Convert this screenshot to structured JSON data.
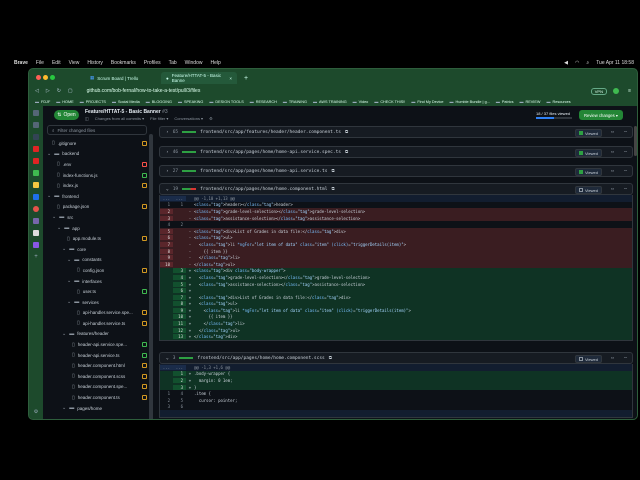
{
  "menubar": {
    "apple": "",
    "items": [
      "Brave",
      "File",
      "Edit",
      "View",
      "History",
      "Bookmarks",
      "Profiles",
      "Tab",
      "Window",
      "Help"
    ],
    "clock": "Tue Apr 11 18:58"
  },
  "tabs": [
    {
      "label": "Scrum Board | Trello"
    },
    {
      "label": "Feature/HTTAT-5 - Basic Banne"
    }
  ],
  "new_tab": "+",
  "address": "github.com/bob-fernal/how-to-take-a-test/pull/3/files",
  "vpn": "VPN",
  "bookmarks": [
    "FDJF",
    "HOME",
    "PROJECTS",
    "Social Media",
    "BLOGGING",
    "SPEAKING",
    "DESIGN TOOLS",
    "RESEARCH",
    "TRAINING",
    "AWS TRAINING",
    "Video",
    "CHECK THIS!!",
    "Find My Device",
    "Humble Bundle | g...",
    "Patrics",
    "REVIEW",
    "Resources"
  ],
  "colors": {
    "accent": "#238636",
    "del": "#3a1d21",
    "add": "#0f3324",
    "frame": "#1d4a2c"
  },
  "pr": {
    "state": "Open",
    "title": "Feature/HTTAT-5 - Basic Banner",
    "number": "#3",
    "changes": "Changes from all commits ▾",
    "file_filter": "File filter ▾",
    "conversations": "Conversations ▾",
    "files_viewed": "18 / 37 files viewed",
    "viewed_fraction": 0.49,
    "review": "Review changes ▾"
  },
  "filter_placeholder": "Filter changed files",
  "tree": [
    {
      "d": 0,
      "t": "f",
      "n": ".gitignore",
      "s": "mod"
    },
    {
      "d": 0,
      "t": "d",
      "n": "backend"
    },
    {
      "d": 1,
      "t": "f",
      "n": ".env",
      "s": "del"
    },
    {
      "d": 1,
      "t": "f",
      "n": "index-functions.js",
      "s": "add"
    },
    {
      "d": 1,
      "t": "f",
      "n": "index.js",
      "s": "mod"
    },
    {
      "d": 0,
      "t": "d",
      "n": "frontend"
    },
    {
      "d": 1,
      "t": "f",
      "n": "package.json",
      "s": "mod"
    },
    {
      "d": 1,
      "t": "d",
      "n": "src"
    },
    {
      "d": 2,
      "t": "d",
      "n": "app"
    },
    {
      "d": 3,
      "t": "f",
      "n": "app.module.ts",
      "s": "mod"
    },
    {
      "d": 3,
      "t": "d",
      "n": "core"
    },
    {
      "d": 4,
      "t": "d",
      "n": "constants"
    },
    {
      "d": 5,
      "t": "f",
      "n": "config.json",
      "s": "mod"
    },
    {
      "d": 4,
      "t": "d",
      "n": "interfaces"
    },
    {
      "d": 5,
      "t": "f",
      "n": "user.ts",
      "s": "add"
    },
    {
      "d": 4,
      "t": "d",
      "n": "services"
    },
    {
      "d": 5,
      "t": "f",
      "n": "api-handler.service.spe...",
      "s": "mod"
    },
    {
      "d": 5,
      "t": "f",
      "n": "api-handler.service.ts",
      "s": "mod"
    },
    {
      "d": 3,
      "t": "d",
      "n": "features/header"
    },
    {
      "d": 4,
      "t": "f",
      "n": "header-api.service.spe...",
      "s": "add"
    },
    {
      "d": 4,
      "t": "f",
      "n": "header-api.service.ts",
      "s": "add"
    },
    {
      "d": 4,
      "t": "f",
      "n": "header.component.html",
      "s": "mod"
    },
    {
      "d": 4,
      "t": "f",
      "n": "header.component.scss",
      "s": "mod"
    },
    {
      "d": 4,
      "t": "f",
      "n": "header.component.spe...",
      "s": "mod"
    },
    {
      "d": 4,
      "t": "f",
      "n": "header.component.ts",
      "s": "mod"
    },
    {
      "d": 3,
      "t": "d",
      "n": "pages/home"
    }
  ],
  "viewed_label": "Viewed",
  "collapsed_files": [
    {
      "count": "65",
      "path": "frontend/src/app/features/header/header.component.ts"
    },
    {
      "count": "46",
      "path": "frontend/src/app/pages/home/home-api.service.spec.ts"
    },
    {
      "count": "27",
      "path": "frontend/src/app/pages/home/home-api.service.ts"
    }
  ],
  "file1": {
    "count": "19",
    "path": "frontend/src/app/pages/home/home.component.html",
    "lines": [
      {
        "k": "hunk",
        "o": "...",
        "n": "...",
        "c": "@@ -1,10 +1,13 @@"
      },
      {
        "k": "ctx",
        "o": "1",
        "n": "1",
        "c": "<header></header>"
      },
      {
        "k": "del",
        "o": "2",
        "n": "",
        "c": "<grade-level-selection></grade-level-selection>"
      },
      {
        "k": "del",
        "o": "3",
        "n": "",
        "c": "<assistance-selection></assistance-selection>"
      },
      {
        "k": "ctx",
        "o": "4",
        "n": "2",
        "c": ""
      },
      {
        "k": "del",
        "o": "5",
        "n": "",
        "c": "<div>List of Grades in data file:</div>"
      },
      {
        "k": "del",
        "o": "6",
        "n": "",
        "c": "<ul>"
      },
      {
        "k": "del",
        "o": "7",
        "n": "",
        "c": "  <li *ngFor=\"let item of data\" class=\"item\" (click)=\"triggerDetails(item)\">"
      },
      {
        "k": "del",
        "o": "8",
        "n": "",
        "c": "    {{ item }}"
      },
      {
        "k": "del",
        "o": "9",
        "n": "",
        "c": "  </li>"
      },
      {
        "k": "del",
        "o": "10",
        "n": "",
        "c": "</ul>"
      },
      {
        "k": "add",
        "o": "",
        "n": "3",
        "c": "<div class=\"body-wrapper\">"
      },
      {
        "k": "add",
        "o": "",
        "n": "4",
        "c": "  <grade-level-selection></grade-level-selection>"
      },
      {
        "k": "add",
        "o": "",
        "n": "5",
        "c": "  <assistance-selection></assistance-selection>"
      },
      {
        "k": "add",
        "o": "",
        "n": "6",
        "c": ""
      },
      {
        "k": "add",
        "o": "",
        "n": "7",
        "c": "  <div>List of Grades in data file:</div>"
      },
      {
        "k": "add",
        "o": "",
        "n": "8",
        "c": "  <ul>"
      },
      {
        "k": "add",
        "o": "",
        "n": "9",
        "c": "    <li *ngFor=\"let item of data\" class=\"item\" (click)=\"triggerDetails(item)\">"
      },
      {
        "k": "add",
        "o": "",
        "n": "10",
        "c": "      {{ item }}"
      },
      {
        "k": "add",
        "o": "",
        "n": "11",
        "c": "    </li>"
      },
      {
        "k": "add",
        "o": "",
        "n": "12",
        "c": "  </ul>"
      },
      {
        "k": "add",
        "o": "",
        "n": "13",
        "c": "</div>"
      }
    ]
  },
  "file2": {
    "count": "3",
    "path": "frontend/src/app/pages/home/home.component.scss",
    "lines": [
      {
        "k": "hunk",
        "o": "...",
        "n": "...",
        "c": "@@ -1,3 +1,6 @@"
      },
      {
        "k": "add",
        "o": "",
        "n": "1",
        "c": ".body-wrapper {"
      },
      {
        "k": "add",
        "o": "",
        "n": "2",
        "c": "  margin: 0 1em;"
      },
      {
        "k": "add",
        "o": "",
        "n": "3",
        "c": "}"
      },
      {
        "k": "ctx",
        "o": "1",
        "n": "4",
        "c": ".item {"
      },
      {
        "k": "ctx",
        "o": "2",
        "n": "5",
        "c": "  cursor: pointer;"
      },
      {
        "k": "ctx",
        "o": "3",
        "n": "6",
        "c": ""
      },
      {
        "k": "hunk",
        "o": "",
        "n": "",
        "c": ""
      }
    ]
  }
}
